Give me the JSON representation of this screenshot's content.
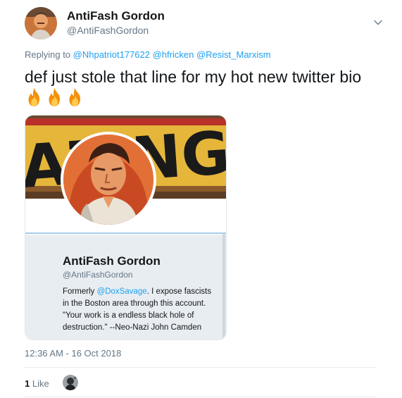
{
  "author": {
    "name": "AntiFash Gordon",
    "handle": "@AntiFashGordon"
  },
  "reply": {
    "prefix": "Replying to ",
    "mentions": [
      "@Nhpatriot177622",
      "@hfricken",
      "@Resist_Marxism"
    ]
  },
  "tweet": {
    "text": "def just stole that line for my hot new twitter bio",
    "emoji": [
      "fire-emoji",
      "fire-emoji",
      "fire-emoji"
    ]
  },
  "quoted_profile": {
    "banner_text": "AZINGS",
    "name": "AntiFash Gordon",
    "handle": "@AntiFashGordon",
    "bio_before": "Formerly ",
    "bio_mention": "@DoxSavage",
    "bio_after": ". I expose fascists in the Boston area through this account. \"Your work is a endless black hole of destruction.\" --Neo-Nazi John Camden"
  },
  "meta": {
    "timestamp": "12:36 AM - 16 Oct 2018",
    "like_count": "1",
    "like_label": "Like"
  },
  "colors": {
    "accent": "#1da1f2",
    "text": "#14171a",
    "secondary": "#657786",
    "card_bg": "#e8edf1",
    "banner_yellow": "#e5b63a",
    "banner_red": "#b8322a"
  }
}
